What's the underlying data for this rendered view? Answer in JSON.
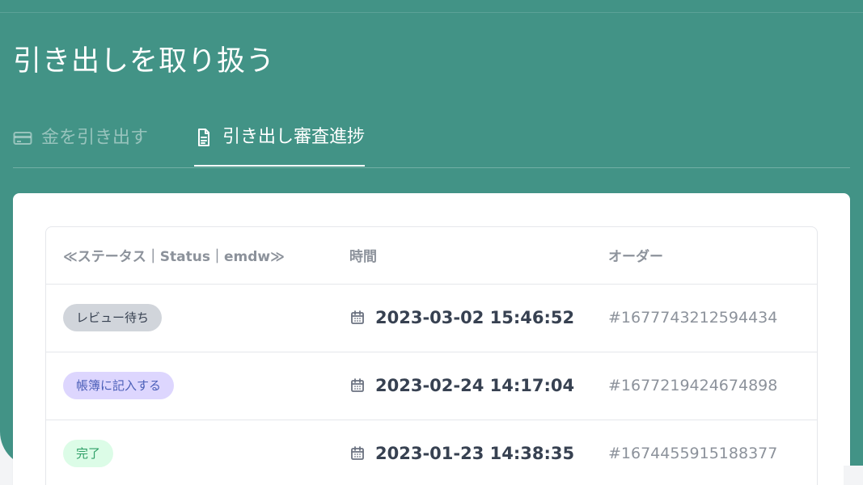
{
  "page": {
    "title": "引き出しを取り扱う"
  },
  "tabs": [
    {
      "label": "金を引き出す",
      "icon": "credit-card-icon",
      "active": false
    },
    {
      "label": "引き出し審査進捗",
      "icon": "document-icon",
      "active": true
    }
  ],
  "table": {
    "columns": [
      "≪ステータス｜Status｜emdw≫",
      "時間",
      "オーダー"
    ],
    "rows": [
      {
        "status": "レビュー待ち",
        "status_color": "#d1d5db",
        "status_text_color": "#374151",
        "time": "2023-03-02 15:46:52",
        "order": "#1677743212594434"
      },
      {
        "status": "帳簿に記入する",
        "status_color": "#ddd6fe",
        "status_text_color": "#4b5fb8",
        "time": "2023-02-24 14:17:04",
        "order": "#1677219424674898"
      },
      {
        "status": "完了",
        "status_color": "#dcfce7",
        "status_text_color": "#2f9f67",
        "time": "2023-01-23 14:38:35",
        "order": "#1674455915188377"
      }
    ]
  },
  "colors": {
    "header_background": "#429386",
    "page_background": "#f3f4f6",
    "card_background": "#ffffff"
  }
}
